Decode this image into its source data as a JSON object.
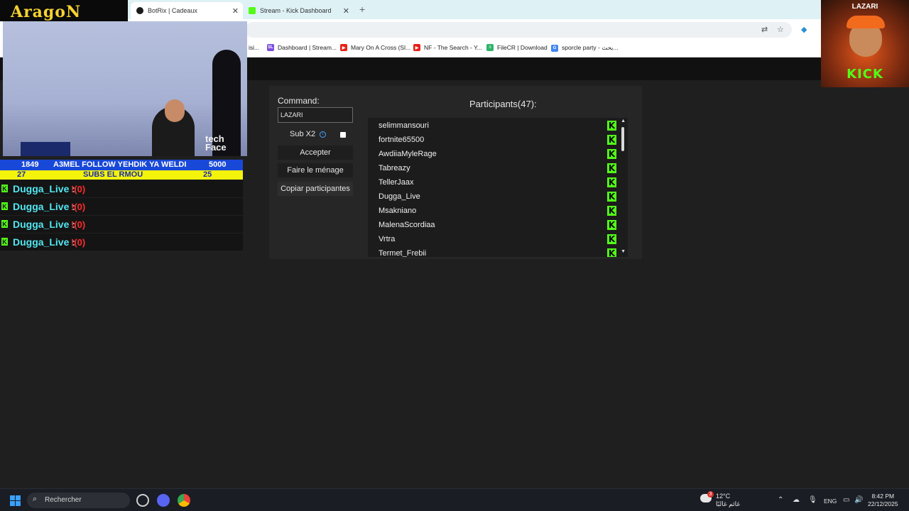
{
  "browser": {
    "tabs": [
      {
        "label": "BotRix | Cadeaux",
        "active": true
      },
      {
        "label": "Stream - Kick Dashboard",
        "active": false
      }
    ],
    "new_tab": "+",
    "close_glyph": "✕",
    "bookmarks": [
      {
        "label": "isi...",
        "icon": "bookmark-generic-icon"
      },
      {
        "label": "Dashboard | Stream...",
        "icon": "streamlabs-icon"
      },
      {
        "label": "Mary On A Cross (Sl...",
        "icon": "youtube-icon"
      },
      {
        "label": "NF - The Search - Y...",
        "icon": "youtube-icon"
      },
      {
        "label": "FileCR | Download",
        "icon": "filecr-icon"
      },
      {
        "label": "sporcle party - بحث...",
        "icon": "google-icon"
      }
    ]
  },
  "giveaway": {
    "command_label": "Command:",
    "command_value": "LAZARI",
    "sub_label": "Sub X2",
    "info_glyph": "i",
    "accept_label": "Accepter",
    "clean_label": "Faire le ménage",
    "copy_label": "Copiar participantes",
    "participants_title": "Participants(47):",
    "participants": [
      "selimmansouri",
      "fortnite65500",
      "AwdiiaMyleRage",
      "Tabreazy",
      "TellerJaax",
      "Dugga_Live",
      "Msakniano",
      "MalenaScordiaa",
      "Vrtra",
      "Termet_Frebii"
    ],
    "platform_glyph": "K",
    "scroll_up": "▲",
    "scroll_down": "▼"
  },
  "overlay": {
    "logo_text": "AragoN",
    "cam_watermark_line1": "tech",
    "cam_watermark_line2": "Face",
    "ticker_top": {
      "left": "1849",
      "center": "A3MEL FOLLOW YEHDIK YA WELDI",
      "right": "5000"
    },
    "ticker_bottom": {
      "left": "27",
      "center": "SUBS EL RMOU",
      "right": "25"
    },
    "chat": [
      {
        "user": "Dugga_Live :",
        "message": "!(0)"
      },
      {
        "user": "Dugga_Live :",
        "message": "!(0)"
      },
      {
        "user": "Dugga_Live :",
        "message": "!(0)"
      },
      {
        "user": "Dugga_Live :",
        "message": "!(0)"
      }
    ]
  },
  "thumbnail": {
    "name": "LAZARI",
    "brand": "KICK"
  },
  "taskbar": {
    "search_placeholder": "Rechercher",
    "weather_temp": "12°C",
    "weather_badge": "3",
    "weather_desc": "غائم غالبًا",
    "lang": "ENG",
    "time": "8:42 PM",
    "date": "22/12/2025"
  },
  "colors": {
    "kick_green": "#53fc18",
    "panel_bg": "#262626",
    "chat_user": "#53e7f0",
    "chat_msg": "#ff2b2b"
  }
}
